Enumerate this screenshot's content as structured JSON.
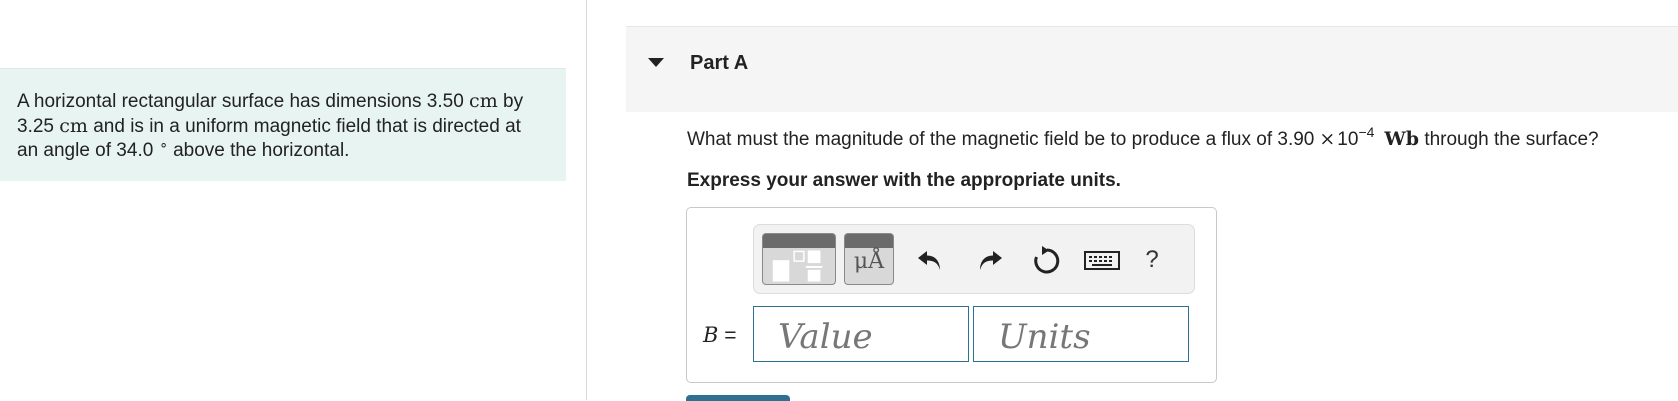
{
  "problem": {
    "text_1": "A horizontal rectangular surface has dimensions 3.50",
    "unit_1": "cm",
    "text_2": "by",
    "text_3": "3.25",
    "unit_2": "cm",
    "text_4": "and is in a uniform magnetic field that is directed at",
    "text_5": "an angle of 34.0",
    "degree": "∘",
    "text_6": "above the horizontal."
  },
  "part": {
    "title": "Part A",
    "question_prefix": "What must the magnitude of the magnetic field be to produce a flux of 3.90",
    "times": "×",
    "base": "10",
    "exponent": "−4",
    "unit": "Wb",
    "question_suffix": "through the surface?",
    "instruction": "Express your answer with the appropriate units."
  },
  "toolbar": {
    "unit_glyph": "μÅ",
    "help_label": "?",
    "icons": [
      "templates-icon",
      "units-icon",
      "undo-icon",
      "redo-icon",
      "reset-icon",
      "keyboard-icon",
      "help-icon"
    ]
  },
  "answer": {
    "variable": "B",
    "equals": "=",
    "value_placeholder": "Value",
    "units_placeholder": "Units"
  },
  "colors": {
    "problem_bg": "#e8f4f2",
    "part_header_bg": "#f5f5f5",
    "field_border": "#2f6f92"
  }
}
